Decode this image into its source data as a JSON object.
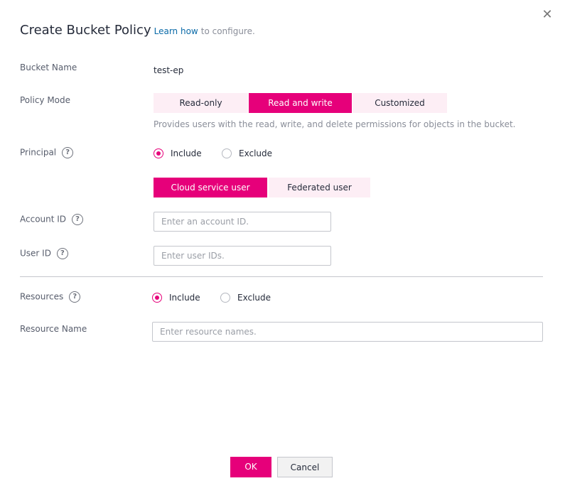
{
  "dialog": {
    "title": "Create Bucket Policy",
    "learn_link": "Learn how",
    "learn_tail": "to configure."
  },
  "bucket_name": {
    "label": "Bucket Name",
    "value": "test-ep"
  },
  "policy_mode": {
    "label": "Policy Mode",
    "options": [
      "Read-only",
      "Read and write",
      "Customized"
    ],
    "selected": "Read and write",
    "hint": "Provides users with the read, write, and delete permissions for objects in the bucket."
  },
  "principal": {
    "label": "Principal",
    "include": "Include",
    "exclude": "Exclude",
    "selected": "Include",
    "user_types": [
      "Cloud service user",
      "Federated user"
    ],
    "selected_user_type": "Cloud service user"
  },
  "account_id": {
    "label": "Account ID",
    "placeholder": "Enter an account ID."
  },
  "user_id": {
    "label": "User ID",
    "placeholder": "Enter user IDs."
  },
  "resources": {
    "label": "Resources",
    "include": "Include",
    "exclude": "Exclude",
    "selected": "Include"
  },
  "resource_name": {
    "label": "Resource Name",
    "placeholder": "Enter resource names."
  },
  "footer": {
    "ok_label": "OK",
    "cancel_label": "Cancel"
  },
  "colors": {
    "accent": "#e6007a",
    "segment_bg": "#fdeef5",
    "link": "#0a6aa8"
  },
  "icons": {
    "close": "close-icon",
    "help": "help-circle-icon"
  }
}
